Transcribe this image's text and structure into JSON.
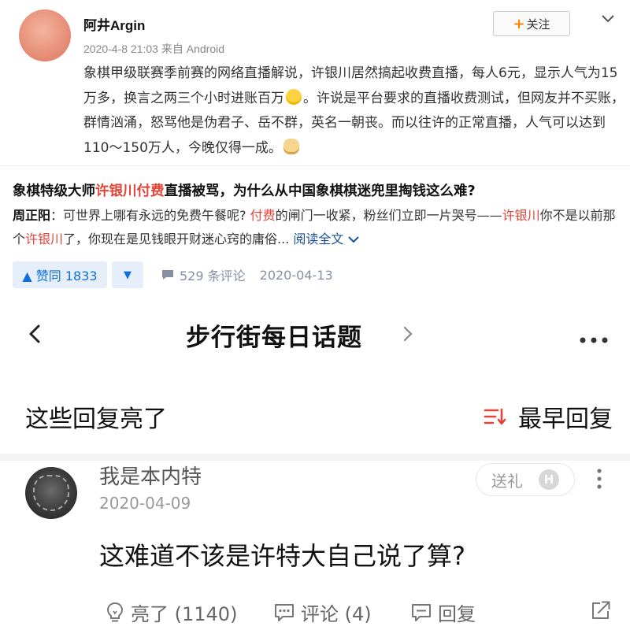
{
  "weibo": {
    "username": "阿井Argin",
    "meta": "2020-4-8 21:03 来自 Android",
    "follow_label": "关注",
    "follow_plus": "+",
    "text_part1": "象棋甲级联赛季前赛的网络直播解说，许银川居然搞起收费直播，每人6元，显示人气为15万多，换言之两三个小时进账百万",
    "text_part2": "。许说是平台要求的直播收费测试，但网友并不买账，群情汹涌，怒骂他是伪君子、岳不群，英名一朝丧。而以往许的正常直播，人气可以达到110～150万人，今晚仅得一成。",
    "emoji1": "surprise-emoji",
    "emoji2": "doge-emoji"
  },
  "zhihu": {
    "title_pre": "象棋特级大师",
    "title_hl": "许银川付费",
    "title_post": "直播被骂，为什么从中国象棋棋迷兜里掏钱这么难?",
    "author": "周正阳",
    "ex1": "：可世界上哪有永远的免费午餐呢? ",
    "ex_hl1": "付费",
    "ex2": "的闸门一收紧，粉丝们立即一片哭号——",
    "ex_hl2": "许银川",
    "ex3": "你不是以前那个",
    "ex_hl3": "许银川",
    "ex4": "了，你现在是见钱眼开财迷心窍的庸俗... ",
    "read_all": "阅读全文",
    "upvote_label": "▲ 赞同 1833",
    "downvote_label": "▼",
    "comments": "529 条评论",
    "date": "2020-04-13",
    "accent_color": "#0f6fdb",
    "highlight_color": "#e0453a"
  },
  "hupu": {
    "nav_title": "步行街每日话题",
    "section_title": "这些回复亮了",
    "sort_label": "最早回复",
    "reply": {
      "username": "我是本内特",
      "date": "2020-04-09",
      "gift_label": "送礼",
      "gift_badge": "H",
      "content": "这难道不该是许特大自己说了算?",
      "light_label": "亮了 (1140)",
      "comment_label": "评论 (4)",
      "reply_label": "回复"
    }
  }
}
